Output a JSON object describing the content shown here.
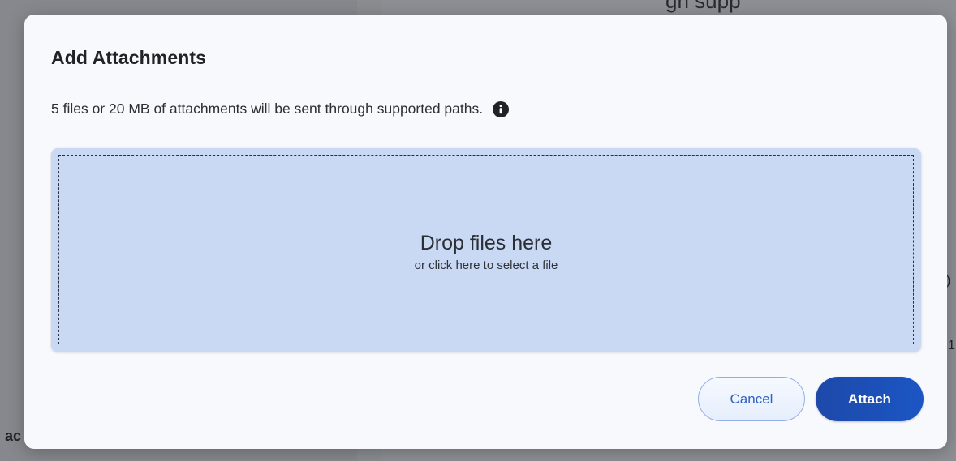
{
  "background": {
    "header_fragment": "gh supp",
    "left_fragment": "ac",
    "right_fragments": [
      ")",
      "1"
    ]
  },
  "modal": {
    "title": "Add Attachments",
    "description": "5 files or 20 MB of attachments will be sent through supported paths.",
    "info_icon": "info-circle-icon",
    "dropzone": {
      "title": "Drop files here",
      "subtitle": "or click here to select a file"
    },
    "buttons": {
      "cancel_label": "Cancel",
      "attach_label": "Attach"
    }
  },
  "colors": {
    "accent": "#1d4fb8",
    "dropzone_bg": "#c9d9f4",
    "modal_bg": "#f7f9fc"
  }
}
